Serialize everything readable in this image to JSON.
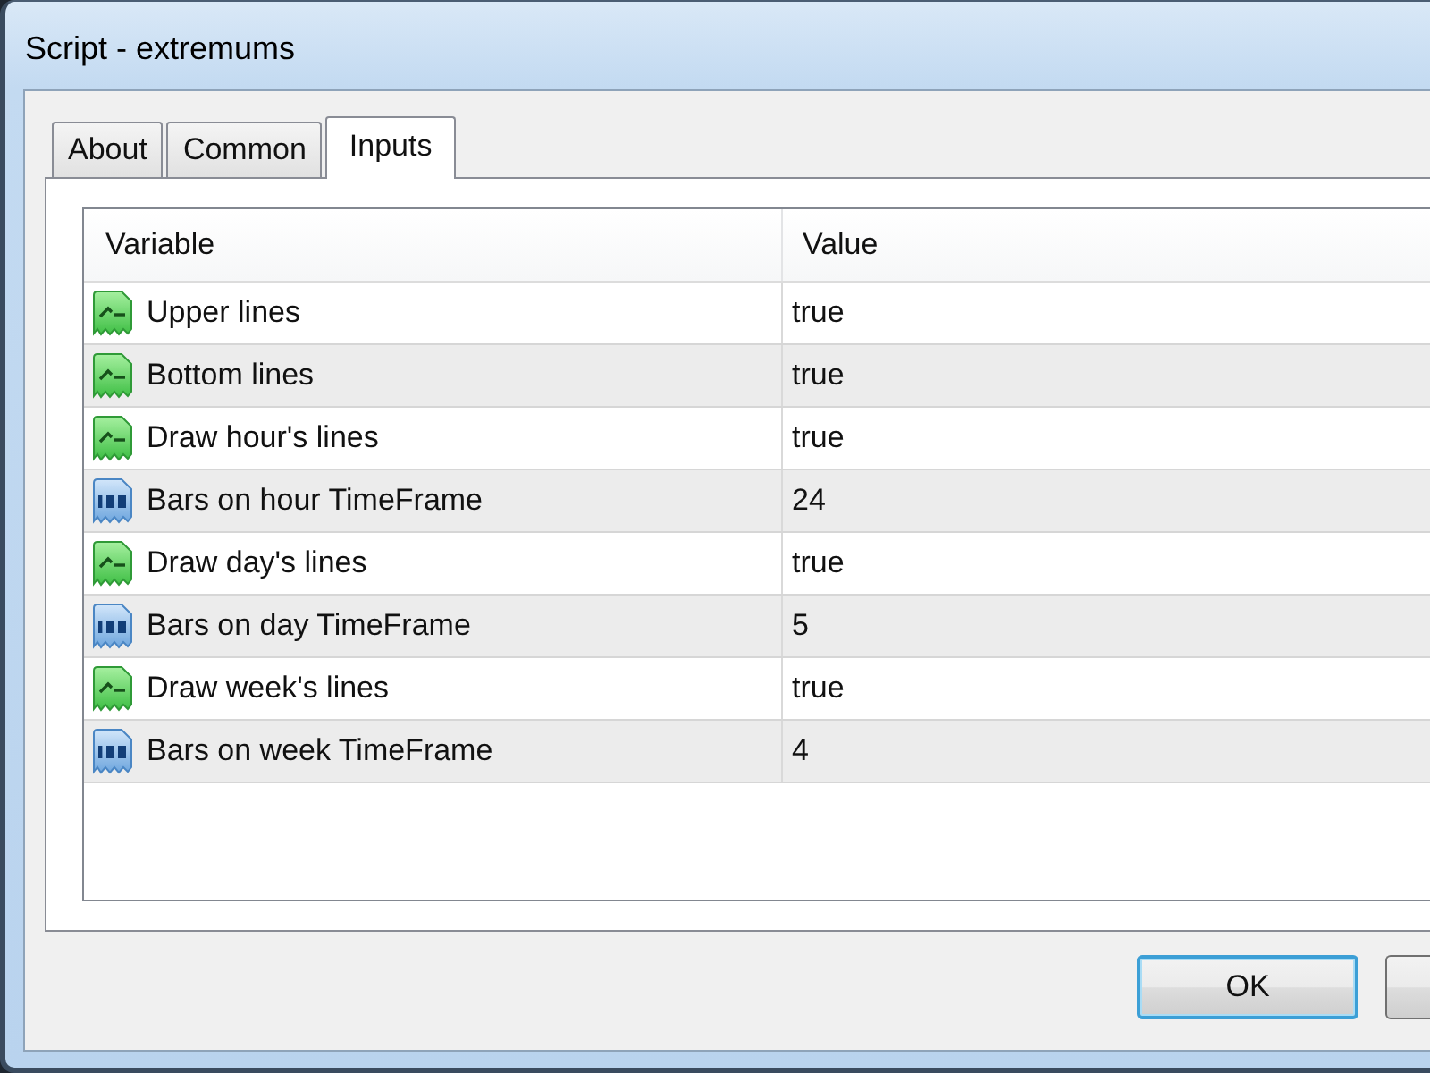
{
  "window": {
    "title": "Script - extremums"
  },
  "tabs": [
    {
      "label": "About",
      "selected": false
    },
    {
      "label": "Common",
      "selected": false
    },
    {
      "label": "Inputs",
      "selected": true
    }
  ],
  "table": {
    "columns": [
      "Variable",
      "Value"
    ],
    "rows": [
      {
        "kind": "bool",
        "variable": "Upper lines",
        "value": "true"
      },
      {
        "kind": "bool",
        "variable": "Bottom lines",
        "value": "true"
      },
      {
        "kind": "bool",
        "variable": "Draw hour's lines",
        "value": "true"
      },
      {
        "kind": "int",
        "variable": "Bars on hour TimeFrame",
        "value": "24"
      },
      {
        "kind": "bool",
        "variable": "Draw day's lines",
        "value": "true"
      },
      {
        "kind": "int",
        "variable": "Bars on day TimeFrame",
        "value": "5"
      },
      {
        "kind": "bool",
        "variable": "Draw week's lines",
        "value": "true"
      },
      {
        "kind": "int",
        "variable": "Bars on week TimeFrame",
        "value": "4"
      }
    ]
  },
  "buttons": [
    {
      "label": "OK",
      "default": true
    },
    {
      "default": false
    }
  ]
}
